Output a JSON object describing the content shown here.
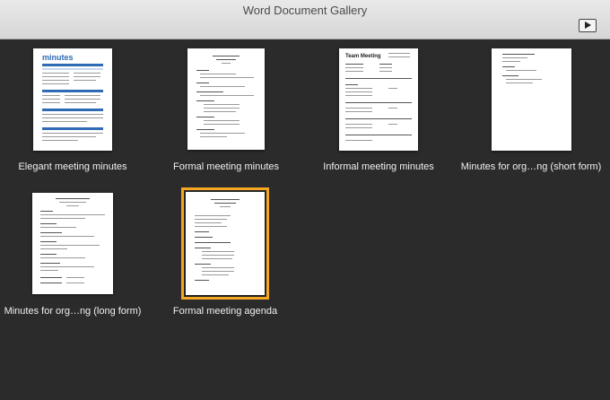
{
  "window": {
    "title": "Word Document Gallery"
  },
  "toolbar": {
    "slideshow_icon": "play-slideshow-icon"
  },
  "templates": [
    {
      "label": "Elegant meeting minutes",
      "selected": false,
      "heading": "minutes"
    },
    {
      "label": "Formal meeting minutes",
      "selected": false
    },
    {
      "label": "Informal meeting minutes",
      "selected": false,
      "heading": "Team Meeting"
    },
    {
      "label": "Minutes for org…ng (short form)",
      "selected": false
    },
    {
      "label": "Minutes for org…ng (long form)",
      "selected": false
    },
    {
      "label": "Formal meeting agenda",
      "selected": true
    }
  ],
  "colors": {
    "selection": "#f5a623",
    "background": "#2b2b2b",
    "accent": "#2f6bb5"
  }
}
